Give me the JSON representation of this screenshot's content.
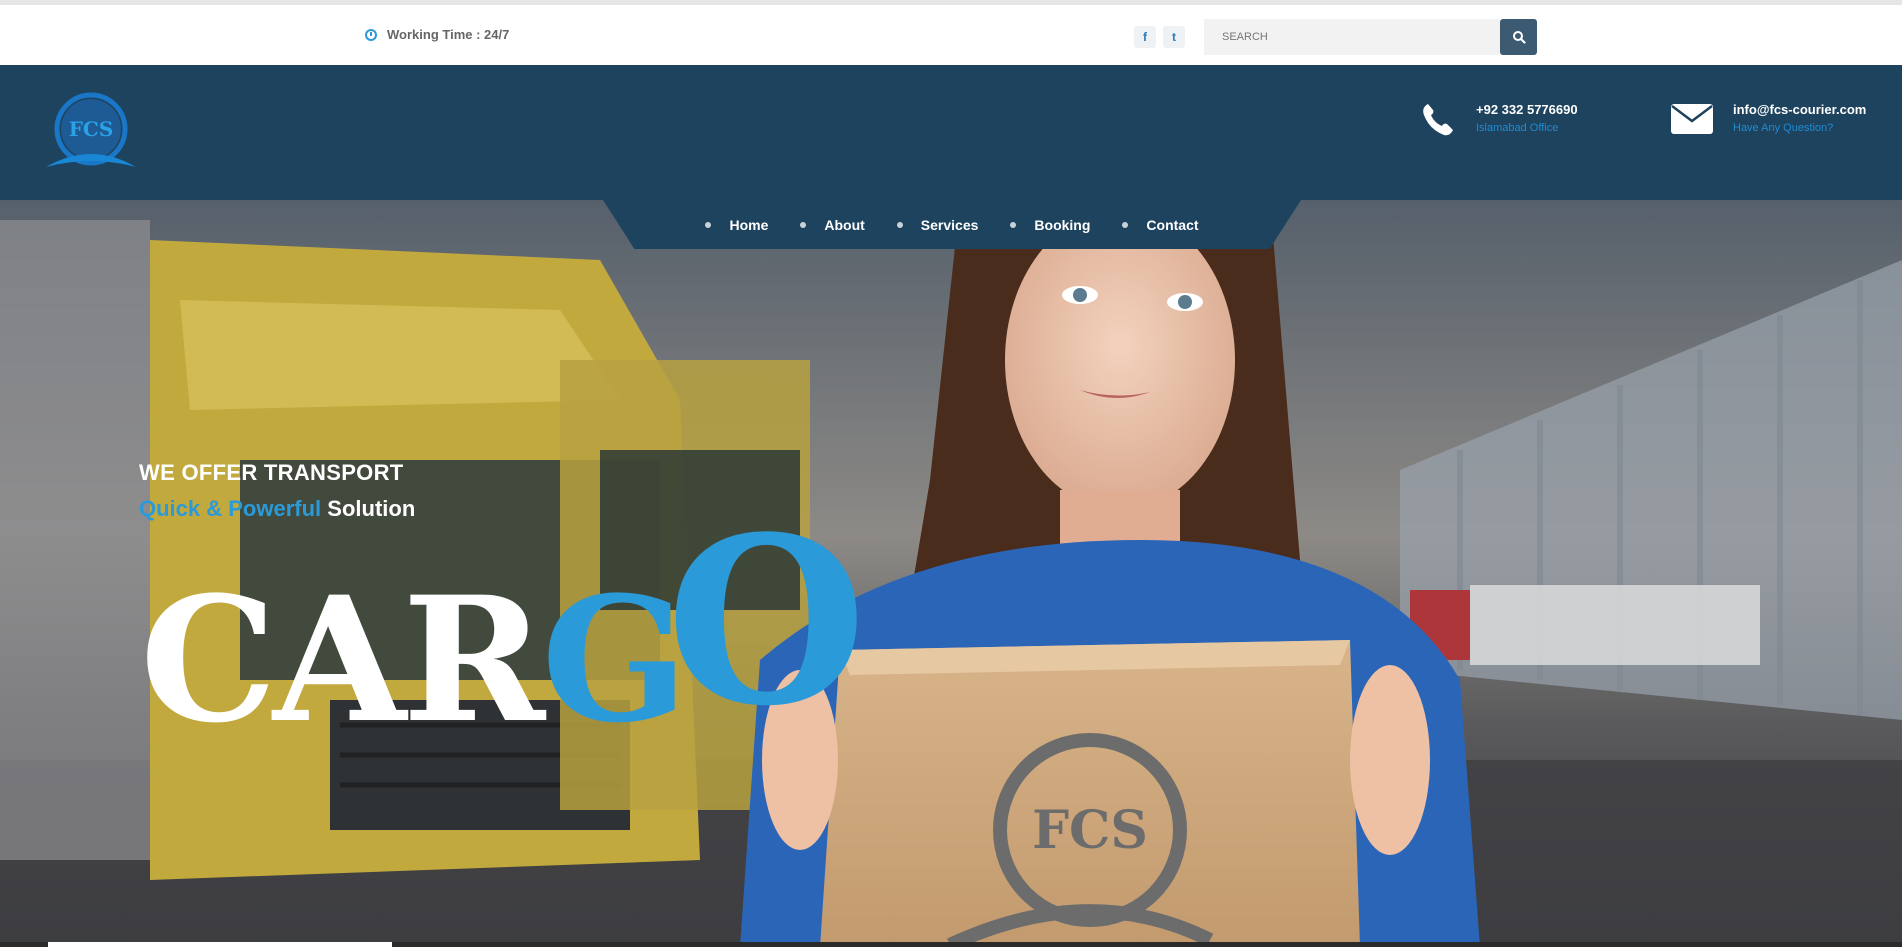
{
  "topbar": {
    "working_time": "Working Time : 24/7",
    "social": {
      "facebook": "f",
      "twitter": "t"
    },
    "search_placeholder": "SEARCH"
  },
  "header": {
    "logo_text": "FCS",
    "phone": {
      "number": "+92 332 5776690",
      "label": "Islamabad Office"
    },
    "email": {
      "address": "info@fcs-courier.com",
      "label": "Have Any Question?"
    }
  },
  "nav": {
    "items": [
      {
        "label": "Home"
      },
      {
        "label": "About"
      },
      {
        "label": "Services"
      },
      {
        "label": "Booking"
      },
      {
        "label": "Contact"
      }
    ]
  },
  "hero": {
    "line1": "WE OFFER TRANSPORT",
    "line2_accent": "Quick & Powerful",
    "line2_plain": "Solution",
    "headline_white": "CAR",
    "headline_blue_g": "G",
    "headline_blue_o": "O",
    "box_logo_text": "FCS"
  },
  "colors": {
    "header_bg": "#1e435f",
    "accent": "#2a9ad8",
    "search_button": "#3d5a73"
  }
}
